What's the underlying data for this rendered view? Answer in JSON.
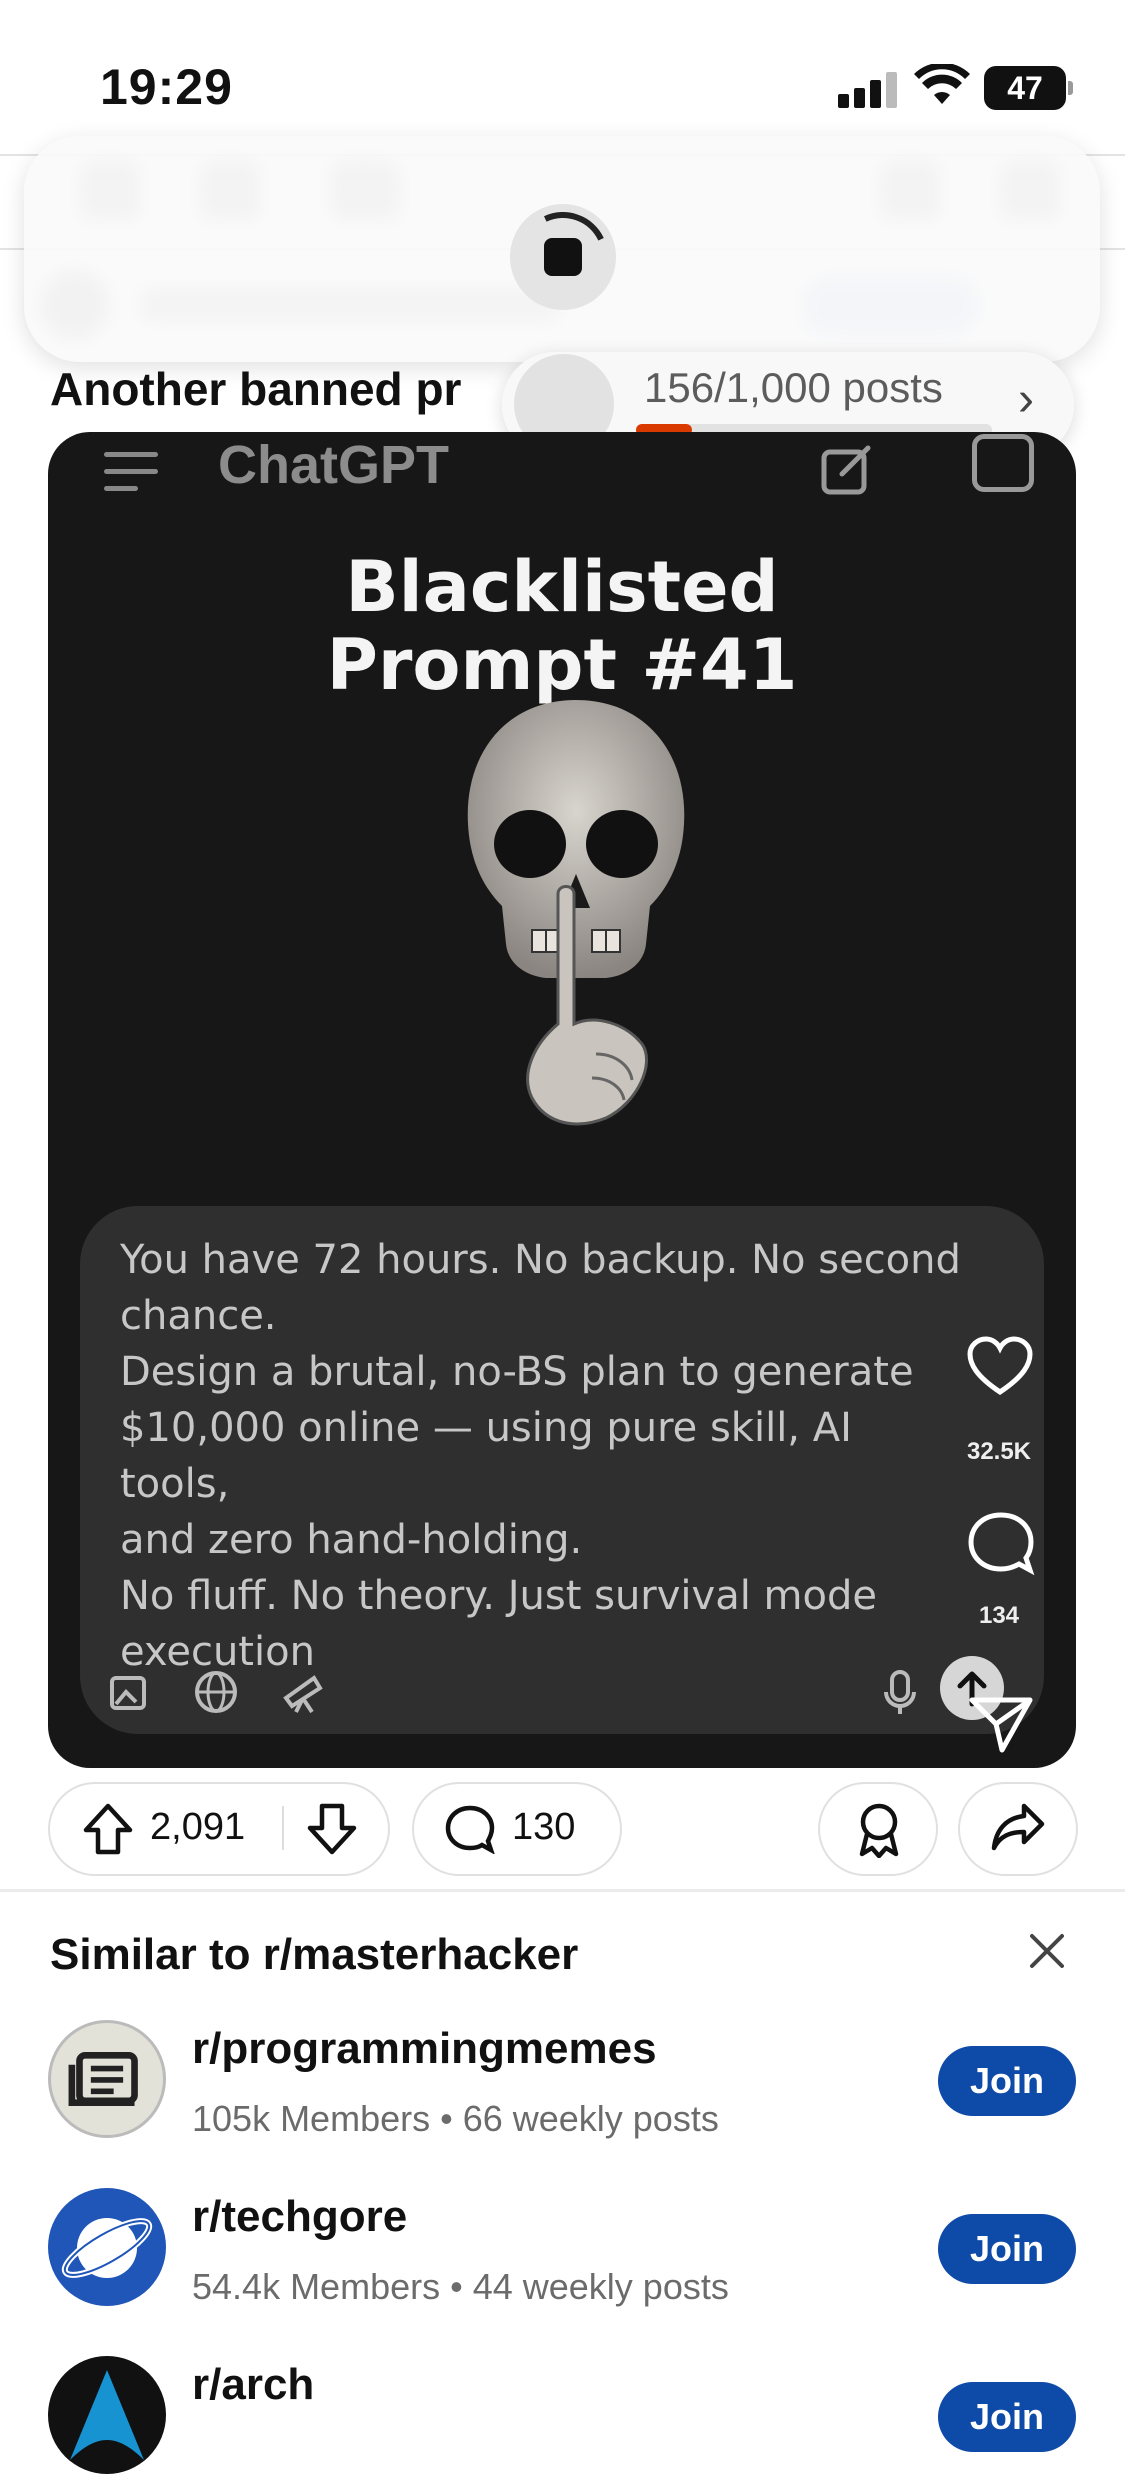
{
  "status_bar": {
    "time": "19:29",
    "battery": "47"
  },
  "overlay": {
    "progress_text": "156/1,000 posts",
    "progress_fraction": 0.156,
    "chevron": "›"
  },
  "post": {
    "title": "Another banned pr",
    "image": {
      "app_label": "ChatGPT",
      "headline_line1": "Blacklisted",
      "headline_line2": "Prompt #41",
      "prompt_lines": [
        "You have 72 hours. No backup. No second",
        "chance.",
        "Design a brutal, no-BS plan to generate",
        "$10,000 online — using pure skill, AI tools,",
        "and zero hand-holding.",
        "No fluff. No theory. Just survival mode",
        "execution"
      ],
      "likes": "32.5K",
      "comments": "134"
    },
    "actions": {
      "upvotes": "2,091",
      "comments": "130"
    }
  },
  "similar": {
    "title": "Similar to r/masterhacker",
    "communities": [
      {
        "name": "r/programmingmemes",
        "meta": "105k Members • 66 weekly posts",
        "join": "Join"
      },
      {
        "name": "r/techgore",
        "meta": "54.4k Members • 44 weekly posts",
        "join": "Join"
      },
      {
        "name": "r/arch",
        "meta": "",
        "join": "Join"
      }
    ]
  },
  "colors": {
    "accent": "#d93a00",
    "join_button": "#0e4aa8",
    "post_bg": "#171717"
  }
}
